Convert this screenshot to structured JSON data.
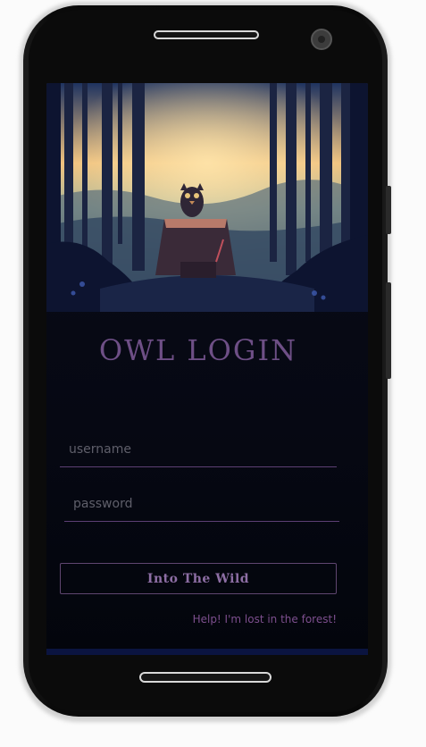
{
  "app": {
    "title": "Owl Login"
  },
  "form": {
    "username_placeholder": "username",
    "username_value": "",
    "password_placeholder": "password",
    "password_value": "",
    "submit_label": "Into The Wild",
    "help_link": "Help! I'm lost in the forest!"
  },
  "colors": {
    "accent": "#6e4f86",
    "screen_bg": "#060813",
    "link": "#7d4f8e"
  }
}
